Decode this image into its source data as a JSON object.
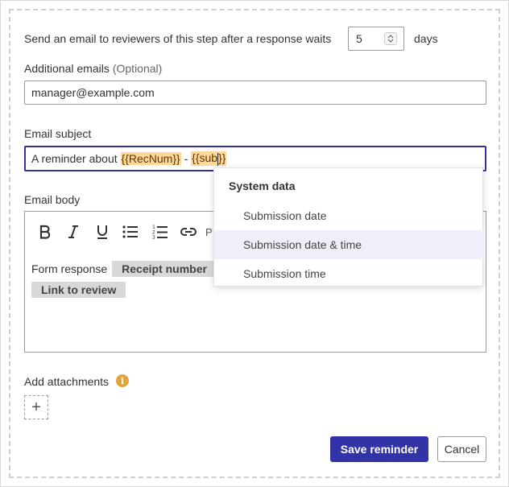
{
  "reminder": {
    "prefix": "Send an email to reviewers of this step after a response waits",
    "days_value": "5",
    "suffix": "days"
  },
  "additional_emails": {
    "label": "Additional emails",
    "optional": "(Optional)",
    "value": "manager@example.com"
  },
  "email_subject": {
    "label": "Email subject",
    "text_before": "A reminder about ",
    "token1": "{{RecNum}}",
    "separator": " - ",
    "token2_before_caret": "{{sub",
    "token2_after_caret": "}}"
  },
  "dropdown": {
    "header": "System data",
    "items": [
      "Submission date",
      "Submission date & time",
      "Submission time"
    ],
    "highlighted_index": 1
  },
  "email_body": {
    "label": "Email body",
    "toolbar_partial_label": "P",
    "line1_text": "Form response",
    "chip_receipt": "Receipt number",
    "chip_link": "Link to review"
  },
  "attachments": {
    "label": "Add attachments",
    "info_glyph": "i",
    "add_glyph": "+"
  },
  "actions": {
    "save_label": "Save reminder",
    "cancel_label": "Cancel"
  },
  "colors": {
    "primary": "#3333a8",
    "token_bg": "#ffd79b",
    "highlight_bg": "#eeeff9",
    "info": "#e2a33a"
  }
}
